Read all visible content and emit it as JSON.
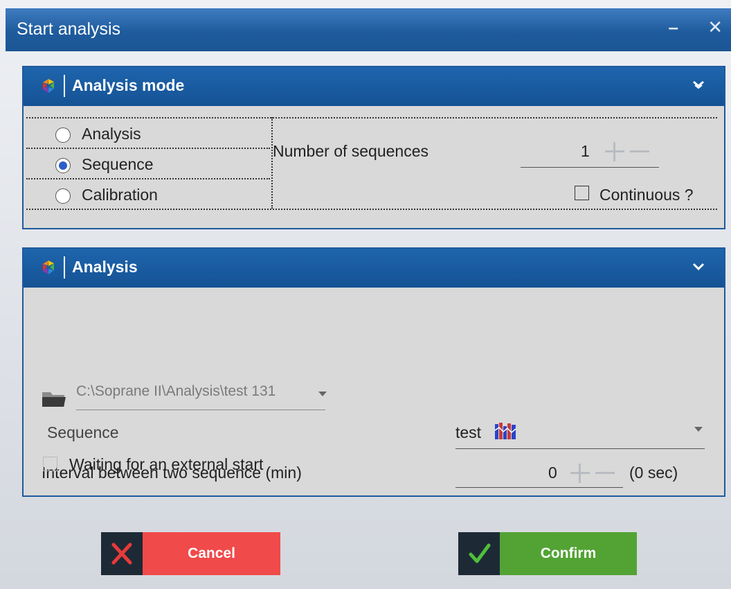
{
  "window": {
    "title": "Start analysis",
    "minimize": "–",
    "close": "✕"
  },
  "mode_panel": {
    "title": "Analysis mode",
    "options": [
      {
        "label": "Analysis",
        "selected": false
      },
      {
        "label": "Sequence",
        "selected": true
      },
      {
        "label": "Calibration",
        "selected": false
      }
    ],
    "sequences_label": "Number of sequences",
    "sequences_value": "1",
    "continuous_label": "Continuous ?",
    "continuous_checked": false
  },
  "analysis_panel": {
    "title": "Analysis",
    "path": "C:\\Soprane II\\Analysis\\test 131",
    "sequence_label": "Sequence",
    "sequence_value": "test",
    "interval_label": "Interval between two sequence (min)",
    "interval_value": "0",
    "interval_seconds": "(0 sec)",
    "external_start_label": "Waiting for an external start",
    "external_start_checked": false
  },
  "buttons": {
    "cancel": "Cancel",
    "confirm": "Confirm"
  },
  "colors": {
    "header_blue": "#1a5aa0",
    "cancel_red": "#f04a4a",
    "confirm_green": "#52a334"
  },
  "icons": [
    "palette-logo-icon",
    "collapse-chevron-icon",
    "folder-icon",
    "sequence-chart-icon",
    "close-x-icon",
    "check-icon"
  ]
}
